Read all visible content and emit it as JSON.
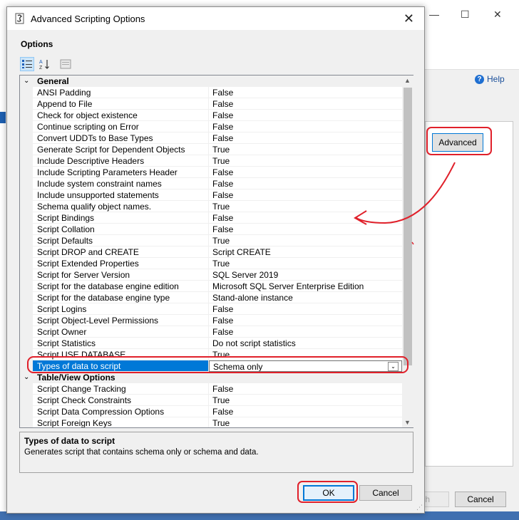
{
  "background_window": {
    "help_label": "Help",
    "advanced_button": "Advanced",
    "cancel_button": "Cancel",
    "disabled_button_partial": "h",
    "controls": {
      "minimize": "—",
      "maximize": "☐",
      "close": "✕"
    }
  },
  "dialog": {
    "title": "Advanced Scripting Options",
    "close_glyph": "✕",
    "options_heading": "Options",
    "toolbar": {
      "categorized_icon": "categorized-icon",
      "alphabetical_icon": "alphabetical-icon",
      "property_pages_icon": "property-pages-icon"
    },
    "categories": [
      {
        "label": "General",
        "rows": [
          {
            "name": "ANSI Padding",
            "value": "False"
          },
          {
            "name": "Append to File",
            "value": "False"
          },
          {
            "name": "Check for object existence",
            "value": "False"
          },
          {
            "name": "Continue scripting on Error",
            "value": "False"
          },
          {
            "name": "Convert UDDTs to Base Types",
            "value": "False"
          },
          {
            "name": "Generate Script for Dependent Objects",
            "value": "True"
          },
          {
            "name": "Include Descriptive Headers",
            "value": "True"
          },
          {
            "name": "Include Scripting Parameters Header",
            "value": "False"
          },
          {
            "name": "Include system constraint names",
            "value": "False"
          },
          {
            "name": "Include unsupported statements",
            "value": "False"
          },
          {
            "name": "Schema qualify object names.",
            "value": "True"
          },
          {
            "name": "Script Bindings",
            "value": "False"
          },
          {
            "name": "Script Collation",
            "value": "False"
          },
          {
            "name": "Script Defaults",
            "value": "True"
          },
          {
            "name": "Script DROP and CREATE",
            "value": "Script CREATE"
          },
          {
            "name": "Script Extended Properties",
            "value": "True"
          },
          {
            "name": "Script for Server Version",
            "value": "SQL Server 2019"
          },
          {
            "name": "Script for the database engine edition",
            "value": "Microsoft SQL Server Enterprise Edition"
          },
          {
            "name": "Script for the database engine type",
            "value": "Stand-alone instance"
          },
          {
            "name": "Script Logins",
            "value": "False"
          },
          {
            "name": "Script Object-Level Permissions",
            "value": "False"
          },
          {
            "name": "Script Owner",
            "value": "False"
          },
          {
            "name": "Script Statistics",
            "value": "Do not script statistics"
          },
          {
            "name": "Script USE DATABASE",
            "value": "True"
          },
          {
            "name": "Types of data to script",
            "value": "Schema only",
            "selected": true
          }
        ]
      },
      {
        "label": "Table/View Options",
        "rows": [
          {
            "name": "Script Change Tracking",
            "value": "False"
          },
          {
            "name": "Script Check Constraints",
            "value": "True"
          },
          {
            "name": "Script Data Compression Options",
            "value": "False"
          },
          {
            "name": "Script Foreign Keys",
            "value": "True"
          }
        ]
      }
    ],
    "description": {
      "title": "Types of data to script",
      "text": "Generates script that contains schema only or schema and data."
    },
    "ok_button": "OK",
    "cancel_button": "Cancel"
  },
  "colors": {
    "selection": "#0078d7",
    "annotation": "#e0202a",
    "dialog_bg": "#f0f0f0"
  }
}
